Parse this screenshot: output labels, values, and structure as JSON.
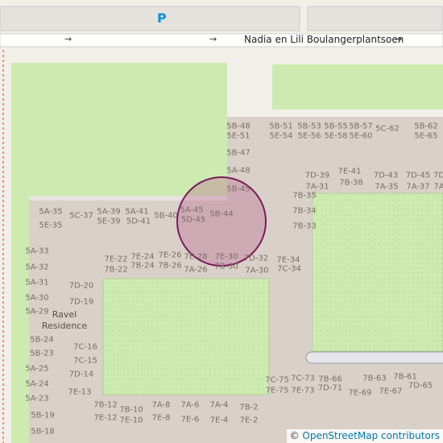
{
  "map": {
    "street_name": "Nadia en Lili Boulangerplantsoen",
    "parking_symbol": "P",
    "oneway_arrow": "→",
    "place_name_line1": "Ravel",
    "place_name_line2": "Residence",
    "house_numbers": [
      "5B-48",
      "5E-51",
      "5B-51",
      "5E-54",
      "5B-53",
      "5E-56",
      "5B-55",
      "5E-58",
      "5B-57",
      "5E-60",
      "5C-62",
      "5B-62",
      "5E-65",
      "5B-47",
      "5A-48",
      "7D-39",
      "7E-41",
      "7D-43",
      "7D-45",
      "7D",
      "7A-31",
      "7B-38",
      "7A-35",
      "7A-37",
      "7A",
      "5B-45",
      "7B-35",
      "5A-35",
      "5C-37",
      "5A-39",
      "5A-41",
      "5A-45",
      "5E-35",
      "5E-39",
      "5D-41",
      "5B-40",
      "5D-45",
      "5B-44",
      "7B-34",
      "7B-33",
      "5A-33",
      "7E-22",
      "7E-24",
      "7E-26",
      "7E-28",
      "7E-30",
      "7D-32",
      "7E-34",
      "7B-22",
      "7B-24",
      "7B-26",
      "7A-26",
      "7B-30",
      "7A-30",
      "7C-34",
      "5A-32",
      "5A-31",
      "7D-20",
      "5A-30",
      "7D-19",
      "5A-29",
      "5B-24",
      "7C-16",
      "5B-23",
      "7C-15",
      "5A-25",
      "7D-14",
      "5A-24",
      "7E-13",
      "5A-23",
      "7C-75",
      "7C-73",
      "7B-66",
      "7B-63",
      "7B-61",
      "7E-75",
      "7E-73",
      "7D-71",
      "7E-69",
      "7E-67",
      "7D-65",
      "7B-12",
      "7B-10",
      "7A-8",
      "7A-6",
      "7A-4",
      "7B-2",
      "5B-19",
      "7E-12",
      "7E-10",
      "7E-8",
      "7E-6",
      "7E-4",
      "7E-2",
      "5B-18"
    ],
    "colors": {
      "background": "#f2efe9",
      "residential": "#d9d0c9",
      "grass": "#cdebb0",
      "water_channel": "#aad3df",
      "marker_fill": "#b85a8c",
      "marker_stroke": "#7a1d5a",
      "boundary": "#e0524f"
    }
  },
  "attribution": {
    "symbol": "©",
    "text": "OpenStreetMap contributors"
  }
}
